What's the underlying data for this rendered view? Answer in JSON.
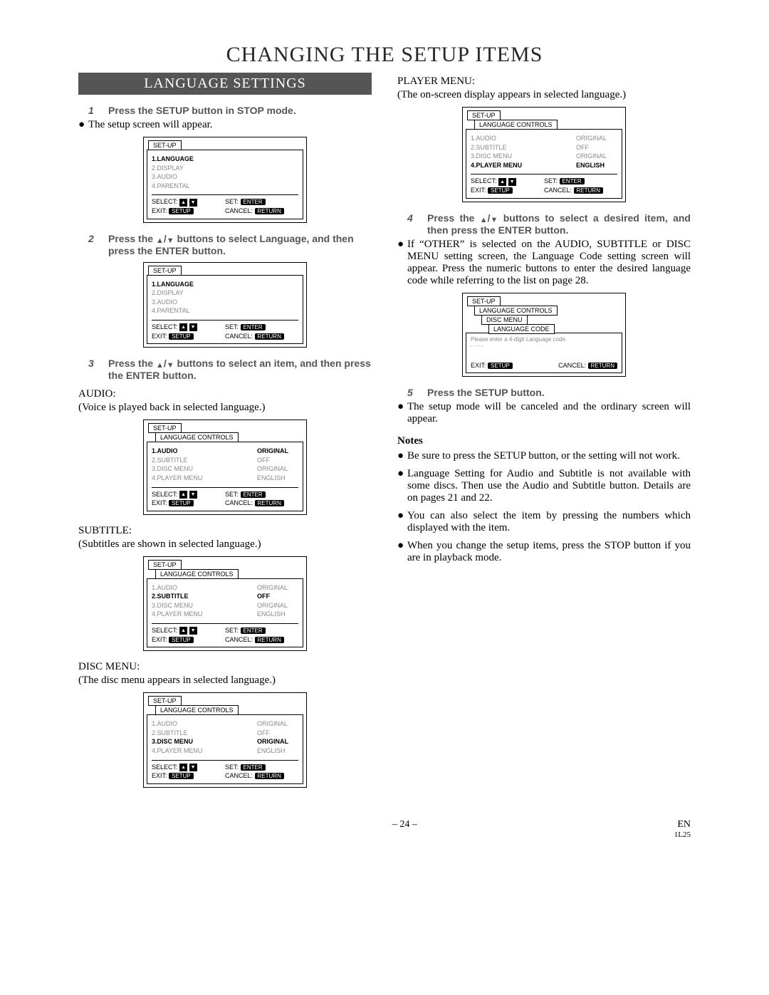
{
  "page_title": "CHANGING THE SETUP ITEMS",
  "section_title": "LANGUAGE SETTINGS",
  "steps": {
    "s1": "Press the SETUP button in STOP mode.",
    "s1_body": "The setup screen will appear.",
    "s2_pre": "Press the ",
    "s2_post": " buttons to select Language, and then press the ENTER button.",
    "s3_pre": "Press the ",
    "s3_post": " buttons to select an item, and then press the ENTER button.",
    "s4_pre": "Press the ",
    "s4_post": " buttons to select a desired item, and then press the ENTER button.",
    "s5": "Press the SETUP button."
  },
  "sub": {
    "audio_h": "AUDIO:",
    "audio_b": "(Voice is played back in selected language.)",
    "subtitle_h": "SUBTITLE:",
    "subtitle_b": "(Subtitles are shown in selected language.)",
    "discmenu_h": "DISC MENU:",
    "discmenu_b": "(The disc menu appears in selected language.)",
    "playermenu_h": "PLAYER MENU:",
    "playermenu_b": "(The on-screen display appears in selected language.)"
  },
  "s4_body": "If “OTHER” is selected on the AUDIO, SUBTITLE or DISC MENU setting screen, the Language Code setting screen will appear. Press the numeric buttons to enter the desired language code while referring to the list on page 28.",
  "s5_body": "The setup mode will be canceled and the ordinary screen will appear.",
  "notes_title": "Notes",
  "notes": {
    "n1": "Be sure to press the SETUP button, or the setting will not work.",
    "n2": "Language Setting for Audio and Subtitle is not available with some discs. Then use the Audio and Subtitle button. Details are on pages 21 and 22.",
    "n3": "You can also select the item by pressing the numbers which displayed with the item.",
    "n4": "When you change the setup items, press the STOP button if you are in playback mode."
  },
  "osd": {
    "setup": "SET-UP",
    "langctrl": "LANGUAGE CONTROLS",
    "discmenu": "DISC MENU",
    "langcode": "LANGUAGE CODE",
    "langcode_msg": "Please enter a 4-digit Language code.",
    "dashes": "- - - -",
    "main_items": [
      "1.LANGUAGE",
      "2.DISPLAY",
      "3.AUDIO",
      "4.PARENTAL"
    ],
    "lang_items": [
      "1.AUDIO",
      "2.SUBTITLE",
      "3.DISC MENU",
      "4.PLAYER MENU"
    ],
    "vals": {
      "original": "ORIGINAL",
      "off": "OFF",
      "english": "ENGLISH"
    },
    "footer": {
      "select": "SELECT:",
      "exit": "EXIT:",
      "set": "SET:",
      "cancel": "CANCEL:",
      "setup": "SETUP",
      "enter": "ENTER",
      "return": "RETURN"
    }
  },
  "footer": {
    "page": "– 24 –",
    "lang": "EN",
    "code": "1L25"
  }
}
